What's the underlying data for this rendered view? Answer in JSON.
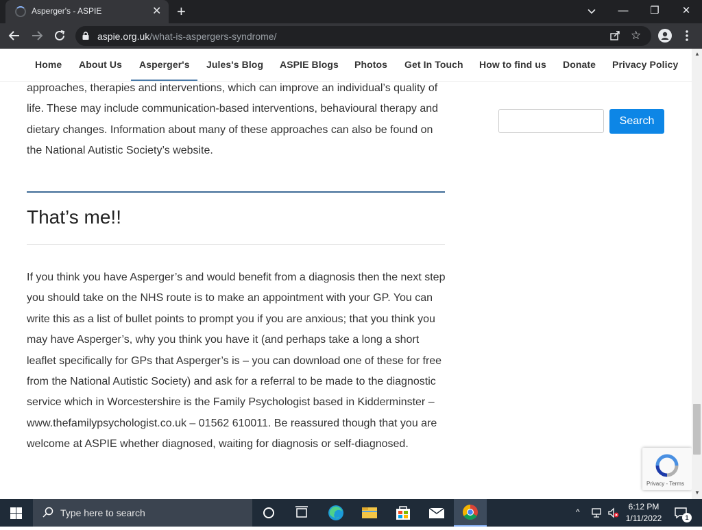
{
  "browser": {
    "tab_title": "Asperger's - ASPIE",
    "tab_close": "✕",
    "new_tab": "+",
    "url_host": "aspie.org.uk",
    "url_path": "/what-is-aspergers-syndrome/",
    "window_controls": {
      "minimize": "—",
      "restore": "❐",
      "close": "✕"
    },
    "star": "☆"
  },
  "site": {
    "nav_items": [
      "Home",
      "About Us",
      "Asperger's",
      "Jules's Blog",
      "ASPIE Blogs",
      "Photos",
      "Get In Touch",
      "How to find us",
      "Donate",
      "Privacy Policy"
    ],
    "active_nav": "Asperger's",
    "intro_paragraph": "approaches, therapies and interventions, which can improve an individual’s quality of life. These may include communication-based interventions, behavioural therapy and dietary changes. Information about many of these approaches can also be found on the National Autistic Society’s website.",
    "section_heading": "That’s me!!",
    "body_paragraph": "If you think you have Asperger’s and would benefit from a diagnosis then the next step you should take on the NHS route is to make an appointment with your GP. You can write this as a list of bullet points to prompt you if you are anxious; that you think you may have Asperger’s, why you think you have it (and perhaps take a long a short leaflet specifically for GPs that Asperger’s is – you can download one of these for free from the National Autistic Society) and ask for a referral to be made to the diagnostic service which in Worcestershire is the Family Psychologist based in Kidderminster – www.thefamilypsychologist.co.uk – 01562 610011. Be reassured though that you are welcome at ASPIE whether diagnosed, waiting for diagnosis or self-diagnosed.",
    "search_placeholder": "",
    "search_button": "Search",
    "recaptcha_links": "Privacy - Terms"
  },
  "taskbar": {
    "search_placeholder": "Type here to search",
    "time": "6:12 PM",
    "date": "1/11/2022",
    "notification_count": "1",
    "tray_up": "^"
  },
  "colors": {
    "accent_blue": "#0d86e6",
    "divider_blue": "#3e6b96",
    "browser_dark": "#202124",
    "taskbar": "#1f2b38"
  }
}
